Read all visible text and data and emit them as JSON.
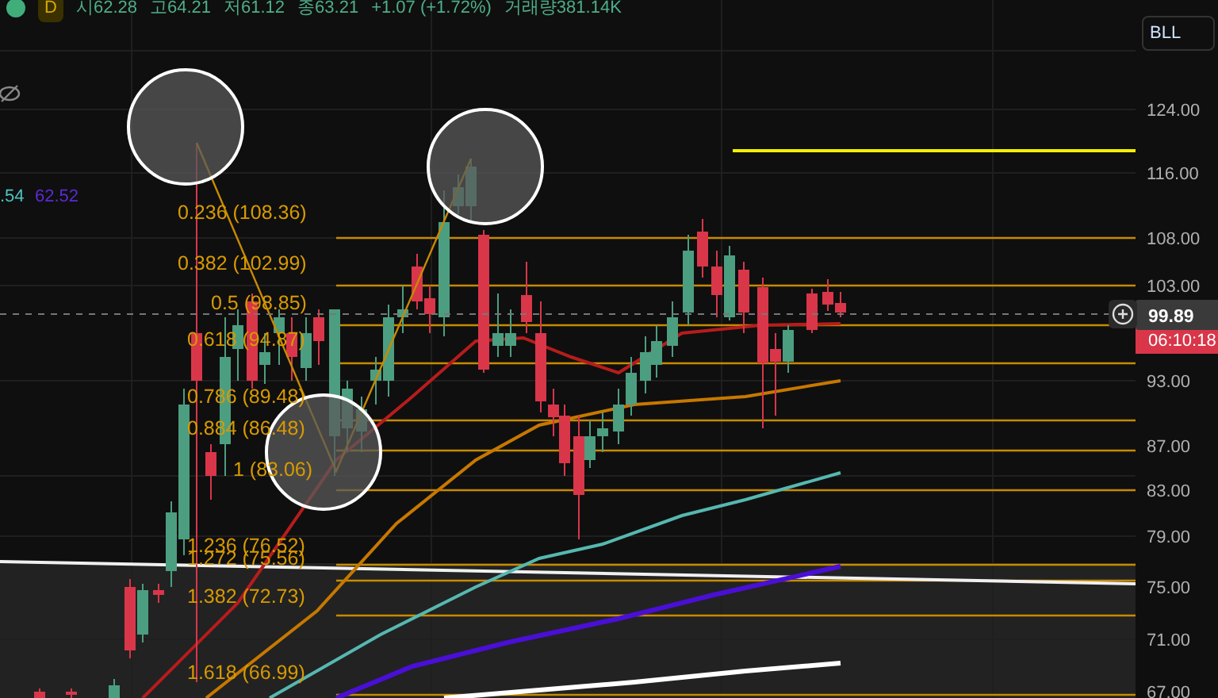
{
  "header": {
    "interval": "D",
    "ohlc": [
      "시62.28",
      "고64.21",
      "저61.12",
      "종63.21"
    ],
    "change": "+1.07 (+1.72%)",
    "volume": "거래량381.14K"
  },
  "symbol_select": {
    "value": "BLL"
  },
  "indicator_values": [
    {
      "text": ".54",
      "color": "#4fc3c3"
    },
    {
      "text": "62.52",
      "color": "#5b2bd6"
    }
  ],
  "fib_levels": [
    {
      "label": "0.236 (108.36)"
    },
    {
      "label": "0.382 (102.99)"
    },
    {
      "label": "0.5 (98.85)"
    },
    {
      "label": "0.618 (94.87)"
    },
    {
      "label": "0.786 (89.48)"
    },
    {
      "label": "0.884 (86.48)"
    },
    {
      "label": "1 (83.06)"
    },
    {
      "label": "1.236 (76.52)"
    },
    {
      "label": "1.272 (75.56)"
    },
    {
      "label": "1.382 (72.73)"
    },
    {
      "label": "1.618 (66.99)"
    }
  ],
  "price_axis": [
    "124.00",
    "116.00",
    "108.00",
    "103.00",
    "93.00",
    "87.00",
    "83.00",
    "79.00",
    "75.00",
    "71.00",
    "67.00"
  ],
  "current_price": {
    "price": "99.89",
    "countdown": "06:10:18"
  }
}
